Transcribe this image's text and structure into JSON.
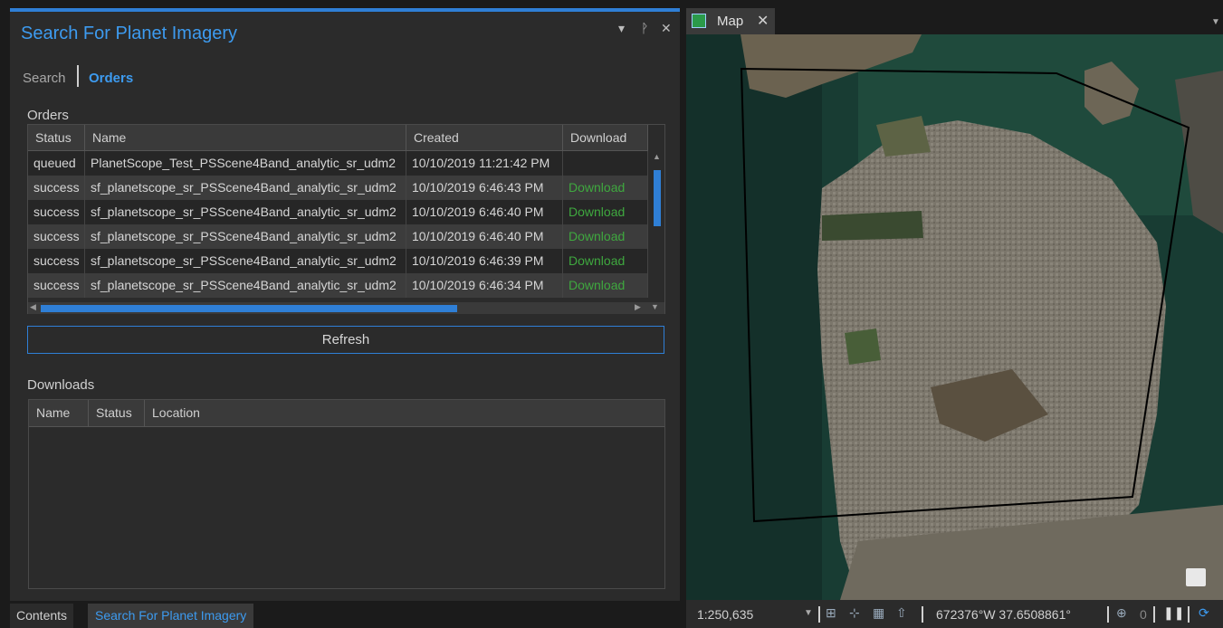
{
  "pane": {
    "title": "Search For Planet Imagery",
    "controls": {
      "menu": "▾",
      "pin": "ᚹ",
      "close": "✕"
    },
    "tabs": {
      "search": "Search",
      "orders": "Orders"
    }
  },
  "orders": {
    "label": "Orders",
    "columns": [
      "Status",
      "Name",
      "Created",
      "Download"
    ],
    "rows": [
      {
        "status": "queued",
        "name": "PlanetScope_Test_PSScene4Band_analytic_sr_udm2",
        "created": "10/10/2019 11:21:42 PM",
        "download": ""
      },
      {
        "status": "success",
        "name": "sf_planetscope_sr_PSScene4Band_analytic_sr_udm2",
        "created": "10/10/2019 6:46:43 PM",
        "download": "Download"
      },
      {
        "status": "success",
        "name": "sf_planetscope_sr_PSScene4Band_analytic_sr_udm2",
        "created": "10/10/2019 6:46:40 PM",
        "download": "Download"
      },
      {
        "status": "success",
        "name": "sf_planetscope_sr_PSScene4Band_analytic_sr_udm2",
        "created": "10/10/2019 6:46:40 PM",
        "download": "Download"
      },
      {
        "status": "success",
        "name": "sf_planetscope_sr_PSScene4Band_analytic_sr_udm2",
        "created": "10/10/2019 6:46:39 PM",
        "download": "Download"
      },
      {
        "status": "success",
        "name": "sf_planetscope_sr_PSScene4Band_analytic_sr_udm2",
        "created": "10/10/2019 6:46:34 PM",
        "download": "Download"
      }
    ]
  },
  "refresh_label": "Refresh",
  "downloads": {
    "label": "Downloads",
    "columns": [
      "Name",
      "Status",
      "Location"
    ]
  },
  "bottom_tabs": {
    "contents": "Contents",
    "search": "Search For Planet Imagery"
  },
  "map": {
    "tab_label": "Map",
    "scale": "1:250,635",
    "coords": "672376°W 37.6508861°",
    "selected_count": "0",
    "colors": {
      "water": "#1f4a3c",
      "land": "#7d776c",
      "footprint": "#000000",
      "accent": "#2f7fd6",
      "download": "#3fa83f"
    }
  }
}
